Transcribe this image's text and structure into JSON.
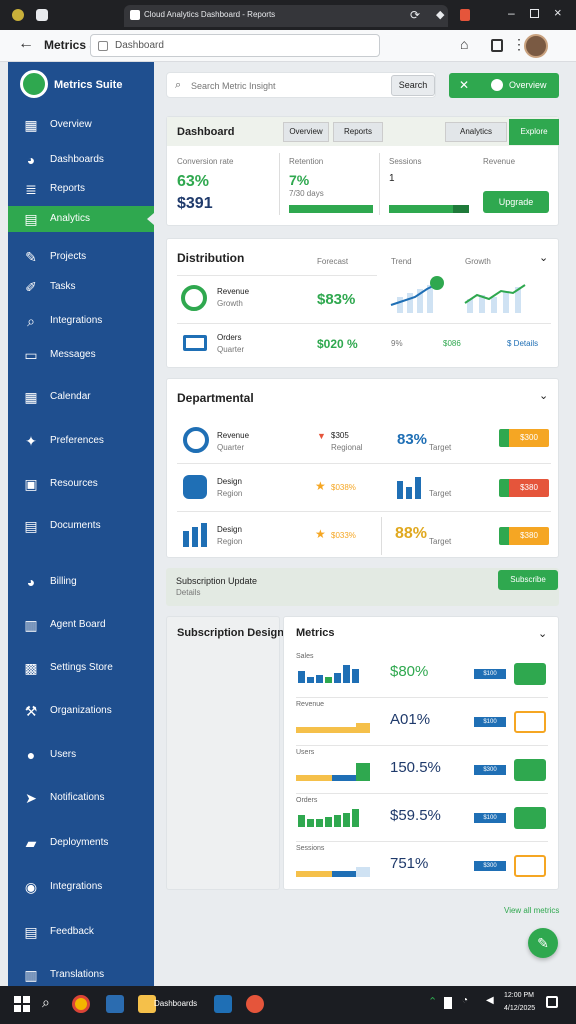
{
  "browser": {
    "tab_title": "Cloud Analytics Dashboard - Reports",
    "address": "Dashboard",
    "back_label": "Back"
  },
  "sidebar": {
    "brand": "Metrics Suite",
    "items": [
      {
        "label": "Overview",
        "icon": "grid-icon"
      },
      {
        "label": "Dashboards",
        "icon": "palette-icon"
      },
      {
        "label": "Reports",
        "icon": "list-icon"
      },
      {
        "label": "Analytics",
        "icon": "chart-icon",
        "active": true
      },
      {
        "label": "Projects",
        "icon": "pencil-icon"
      },
      {
        "label": "Tasks",
        "icon": "edit-icon"
      },
      {
        "label": "Integrations",
        "icon": "search-icon"
      },
      {
        "label": "Messages",
        "icon": "folder-icon"
      },
      {
        "label": "Calendar",
        "icon": "calendar-icon"
      },
      {
        "label": "Preferences",
        "icon": "tool-icon"
      },
      {
        "label": "Resources",
        "icon": "monitor-icon"
      },
      {
        "label": "Documents",
        "icon": "table-icon"
      },
      {
        "label": "Billing",
        "icon": "palette-icon"
      },
      {
        "label": "Agent Board",
        "icon": "bar-chart-icon"
      },
      {
        "label": "Settings Store",
        "icon": "box-icon"
      },
      {
        "label": "Organizations",
        "icon": "hammer-icon"
      },
      {
        "label": "Users",
        "icon": "fruit-icon"
      },
      {
        "label": "Notifications",
        "icon": "send-icon"
      },
      {
        "label": "Deployments",
        "icon": "toolbox-icon"
      },
      {
        "label": "Integrations",
        "icon": "gauge-icon"
      },
      {
        "label": "Feedback",
        "icon": "doc-icon"
      },
      {
        "label": "Translations",
        "icon": "archive-icon"
      }
    ]
  },
  "topbar": {
    "search_placeholder": "Search Metric Insight",
    "search_button": "Search",
    "primary_button": "Overview"
  },
  "card1": {
    "title": "Dashboard",
    "tabs": [
      "Overview",
      "Reports",
      "Analytics",
      "Explore"
    ],
    "cols": [
      {
        "label": "Conversion rate",
        "value": "63%",
        "sub": "$391"
      },
      {
        "label": "Retention",
        "value": "7%",
        "sub": "7/30 days"
      },
      {
        "label": "Sessions",
        "value": "1",
        "sub": ""
      },
      {
        "label": "Revenue",
        "button": "Upgrade"
      }
    ]
  },
  "card2": {
    "title": "Distribution",
    "headers": [
      "Forecast",
      "Trend",
      "Growth"
    ],
    "rows": [
      {
        "name": "Revenue",
        "sub": "Growth",
        "value": "$83%"
      },
      {
        "name": "Orders",
        "sub": "Quarter",
        "value": "$020 %",
        "pct": "9%",
        "pct2": "$086",
        "link": "$ Details"
      }
    ]
  },
  "card3": {
    "title": "Departmental",
    "rows": [
      {
        "name": "Revenue",
        "sub": "Quarter",
        "mid": "$305",
        "mid_sub": "Regional",
        "value": "83%",
        "value_sub": "Target",
        "badge": "$300"
      },
      {
        "name": "Design",
        "sub": "Region",
        "mid": "$038%",
        "value": "",
        "value_sub": "Target",
        "badge": "$380"
      },
      {
        "name": "Design",
        "sub": "Region",
        "mid": "$033%",
        "value": "88%",
        "value_sub": "Target",
        "badge": "$380"
      }
    ]
  },
  "strip": {
    "title": "Subscription Update",
    "sub": "Details",
    "button": "Subscribe"
  },
  "card4": {
    "left_title": "Subscription Design",
    "title": "Metrics",
    "rows": [
      {
        "label": "Sales",
        "value": "$80%",
        "tag": "$100"
      },
      {
        "label": "Revenue",
        "value": "A01%",
        "tag": "$100"
      },
      {
        "label": "Users",
        "value": "150.5%",
        "tag": "$300"
      },
      {
        "label": "Orders",
        "value": "$59.5%",
        "tag": "$100"
      },
      {
        "label": "Sessions",
        "value": "751%",
        "tag": "$300"
      }
    ],
    "footer_link": "View all metrics"
  },
  "taskbar": {
    "app_label": "Dashboards",
    "clock": "12:00 PM",
    "date": "4/12/2025"
  },
  "colors": {
    "sidebar": "#1f4f8f",
    "accent": "#2fa84f",
    "orange": "#f5a623",
    "blue": "#1f6fb5"
  }
}
